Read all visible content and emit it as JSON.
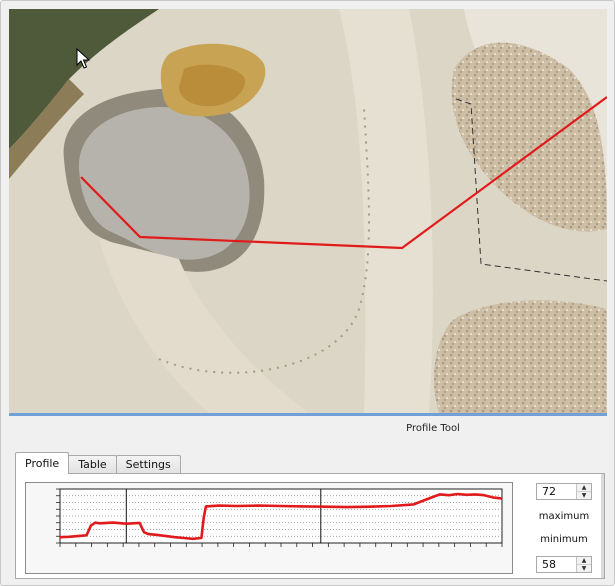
{
  "panel": {
    "title": "Profile Tool",
    "tabs": [
      {
        "label": "Profile",
        "active": true
      },
      {
        "label": "Table",
        "active": false
      },
      {
        "label": "Settings",
        "active": false
      }
    ]
  },
  "controls": {
    "maximum_value": "72",
    "maximum_label": "maximum",
    "minimum_label": "minimum",
    "minimum_value": "58"
  },
  "colors": {
    "profile_line": "#e11b1b",
    "accent": "#6fa0d8"
  },
  "chart_data": {
    "type": "line",
    "title": "",
    "xlabel": "",
    "ylabel": "",
    "ylim": [
      58,
      72
    ],
    "grid": true,
    "x": [
      0,
      2,
      4,
      6,
      7,
      8,
      9,
      12,
      15,
      18,
      19,
      20,
      22,
      24,
      26,
      28,
      30,
      32,
      32.5,
      33,
      36,
      40,
      45,
      50,
      55,
      60,
      65,
      70,
      75,
      80,
      85,
      86,
      88,
      90,
      92,
      94,
      96,
      98,
      100
    ],
    "y": [
      59.5,
      59.6,
      59.8,
      60.0,
      62.5,
      63.3,
      63.1,
      63.3,
      63.0,
      63.2,
      60.8,
      60.3,
      60.1,
      59.8,
      59.5,
      59.3,
      59.1,
      59.3,
      64.5,
      67.5,
      67.7,
      67.6,
      67.7,
      67.6,
      67.5,
      67.4,
      67.3,
      67.4,
      67.6,
      68.0,
      70.2,
      70.6,
      70.4,
      70.7,
      70.5,
      70.6,
      70.4,
      69.8,
      69.5
    ]
  },
  "icons": {
    "cursor": "mouse-pointer-icon",
    "spin_up": "spin-up-arrow-icon",
    "spin_down": "spin-down-arrow-icon"
  }
}
